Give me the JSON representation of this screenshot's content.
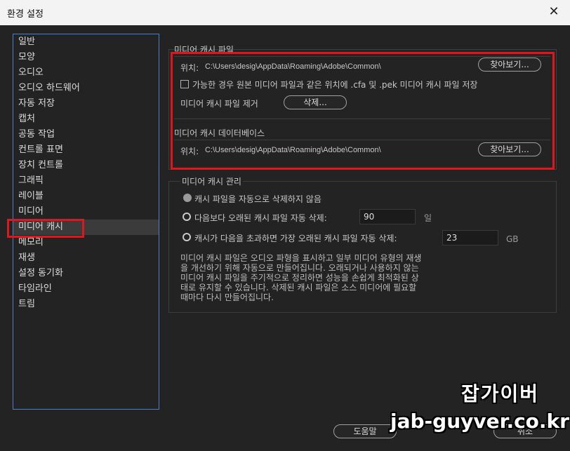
{
  "window": {
    "title": "환경 설정",
    "close_label": "✕"
  },
  "sidebar": {
    "items": [
      {
        "label": "일반"
      },
      {
        "label": "모양"
      },
      {
        "label": "오디오"
      },
      {
        "label": "오디오 하드웨어"
      },
      {
        "label": "자동 저장"
      },
      {
        "label": "캡처"
      },
      {
        "label": "공동 작업"
      },
      {
        "label": "컨트롤 표면"
      },
      {
        "label": "장치 컨트롤"
      },
      {
        "label": "그래픽"
      },
      {
        "label": "레이블"
      },
      {
        "label": "미디어"
      },
      {
        "label": "미디어 캐시"
      },
      {
        "label": "메모리"
      },
      {
        "label": "재생"
      },
      {
        "label": "설정 동기화"
      },
      {
        "label": "타임라인"
      },
      {
        "label": "트림"
      }
    ],
    "selected": "미디어 캐시"
  },
  "media_cache_files": {
    "title": "미디어 캐시 파일",
    "location_label": "위치:",
    "location_path": "C:\\Users\\desig\\AppData\\Roaming\\Adobe\\Common\\",
    "browse_label": "찾아보기...",
    "save_next_checkbox_label": "가능한 경우 원본 미디어 파일과 같은 위치에 .cfa 및 .pek 미디어 캐시 파일 저장",
    "save_next_checked": false,
    "remove_label": "미디어 캐시 파일 제거",
    "delete_label": "삭제..."
  },
  "media_cache_database": {
    "title": "미디어 캐시 데이터베이스",
    "location_label": "위치:",
    "location_path": "C:\\Users\\desig\\AppData\\Roaming\\Adobe\\Common\\",
    "browse_label": "찾아보기..."
  },
  "media_cache_management": {
    "title": "미디어 캐시 관리",
    "options": [
      {
        "label": "캐시 파일을 자동으로 삭제하지 않음",
        "selected": true
      },
      {
        "label": "다음보다 오래된 캐시 파일 자동 삭제:",
        "selected": false,
        "value": "90",
        "unit": "일"
      },
      {
        "label": "캐시가 다음을 초과하면 가장 오래된 캐시 파일 자동 삭제:",
        "selected": false,
        "value": "23",
        "unit": "GB"
      }
    ],
    "description_lines": [
      "미디어 캐시 파일은 오디오 파형을 표시하고 일부 미디어 유형의 재생",
      "을 개선하기 위해 자동으로 만들어집니다. 오래되거나 사용하지 않는",
      "미디어 캐시 파일을 주기적으로 정리하면 성능을 손쉽게 최적화된 상",
      "태로 유지할 수 있습니다. 삭제된 캐시 파일은 소스 미디어에 필요할",
      "때마다 다시 만들어집니다."
    ]
  },
  "footer": {
    "help_label": "도움말",
    "cancel_label": "취소"
  },
  "watermark": {
    "line1": "잡가이버",
    "line2": "jab-guyver.co.kr"
  },
  "colors": {
    "highlight_box": "#e0161f",
    "selection_bg": "#3b3b3b",
    "sidebar_border": "#4a7fc9"
  }
}
